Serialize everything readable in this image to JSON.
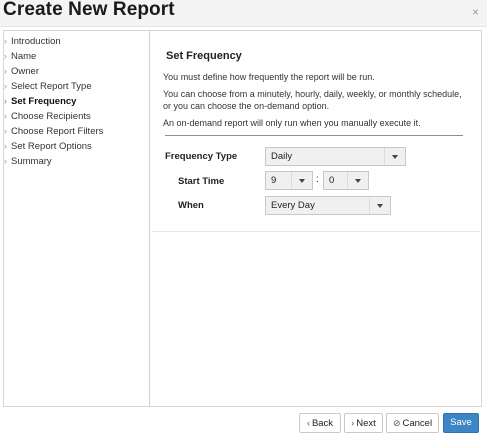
{
  "header": {
    "title": "Create New Report",
    "close_label": "×"
  },
  "sidebar": {
    "items": [
      {
        "label": "Introduction"
      },
      {
        "label": "Name"
      },
      {
        "label": "Owner"
      },
      {
        "label": "Select Report Type"
      },
      {
        "label": "Set Frequency",
        "active": true
      },
      {
        "label": "Choose Recipients"
      },
      {
        "label": "Choose Report Filters"
      },
      {
        "label": "Set Report Options"
      },
      {
        "label": "Summary"
      }
    ]
  },
  "panel": {
    "title": "Set Frequency",
    "paragraphs": [
      "You must define how frequently the report will be run.",
      "You can choose from a minutely, hourly, daily, weekly, or monthly schedule, or you can choose the on-demand option.",
      "An on-demand report will only run when you manually execute it."
    ]
  },
  "form": {
    "frequency_type": {
      "label": "Frequency Type",
      "value": "Daily"
    },
    "start_time": {
      "label": "Start Time",
      "hour": "9",
      "minute": "0",
      "separator": ":"
    },
    "when": {
      "label": "When",
      "value": "Every Day"
    }
  },
  "footer": {
    "back_label": "Back",
    "next_label": "Next",
    "cancel_label": "Cancel",
    "save_label": "Save"
  },
  "colors": {
    "primary": "#3d86c6",
    "header_bg": "#f4f4f4"
  },
  "icons": {
    "chevron": "chevron-right-icon",
    "select": "caret-down-icon",
    "cancel": "ban-icon"
  }
}
